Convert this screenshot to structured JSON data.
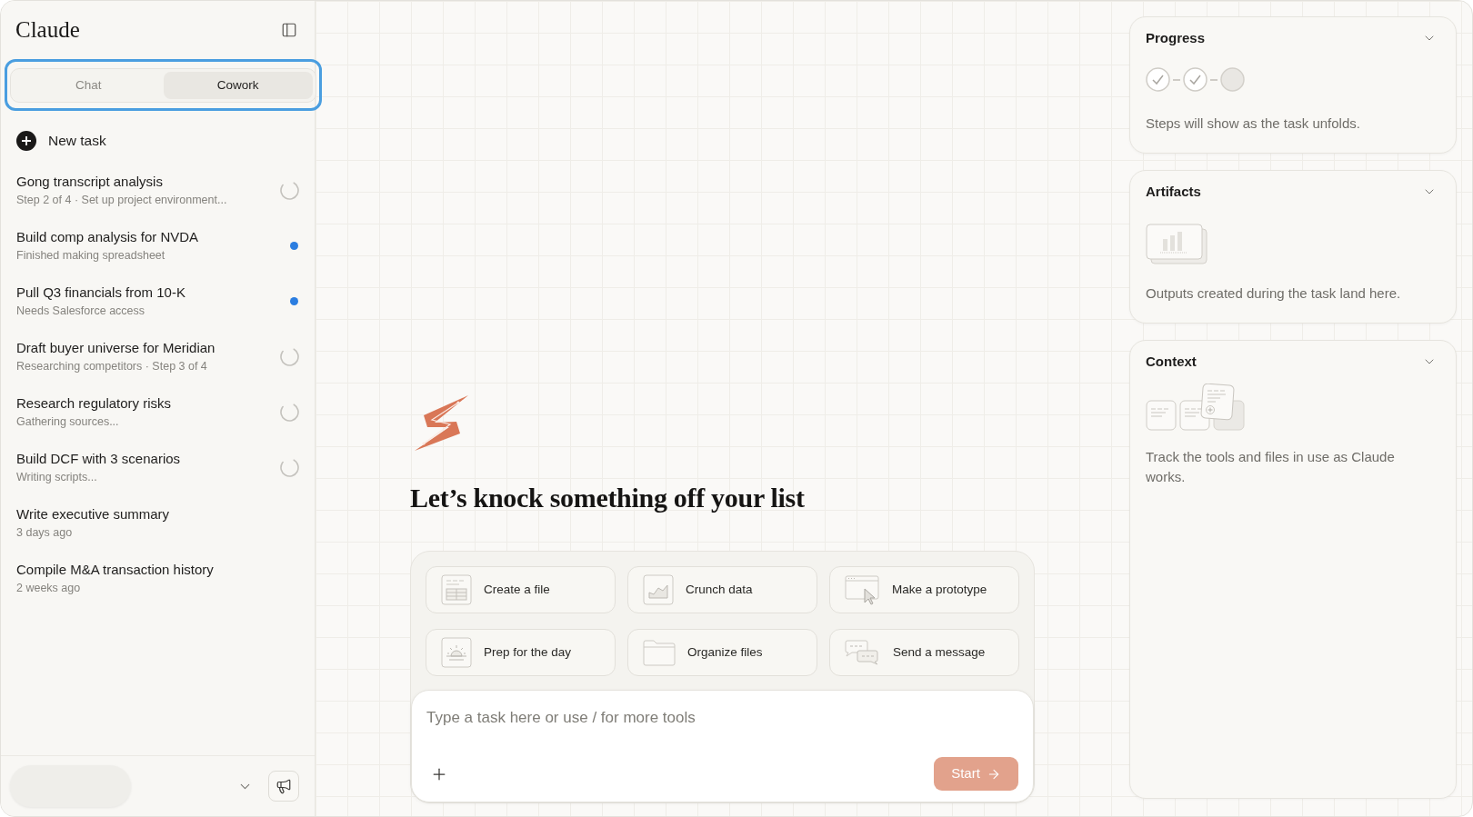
{
  "sidebar": {
    "title": "Claude",
    "mode_tabs": [
      {
        "label": "Chat",
        "selected": false
      },
      {
        "label": "Cowork",
        "selected": true
      }
    ],
    "new_task": "New task",
    "tasks": [
      {
        "title": "Gong transcript analysis",
        "subtitle": "Step 2 of 4 · Set up project environment...",
        "kind": "running"
      },
      {
        "title": "Build comp analysis for NVDA",
        "subtitle": "Finished making spreadsheet",
        "kind": "unread"
      },
      {
        "title": "Pull Q3 financials from 10-K",
        "subtitle": "Needs Salesforce access",
        "kind": "unread"
      },
      {
        "title": "Draft buyer universe for Meridian",
        "subtitle": "Researching competitors · Step 3 of 4",
        "kind": "running"
      },
      {
        "title": "Research regulatory risks",
        "subtitle": "Gathering sources...",
        "kind": "running"
      },
      {
        "title": "Build DCF with 3 scenarios",
        "subtitle": "Writing scripts...",
        "kind": "running"
      },
      {
        "title": "Write executive summary",
        "subtitle": "3 days ago",
        "kind": "idle"
      },
      {
        "title": "Compile M&A transaction history",
        "subtitle": "2 weeks ago",
        "kind": "idle"
      }
    ]
  },
  "main": {
    "heading": "Let’s knock something off your list",
    "quick_actions": [
      "Create a file",
      "Crunch data",
      "Make a prototype",
      "Prep for the day",
      "Organize files",
      "Send a message"
    ],
    "task_input": {
      "placeholder": "Type a task here or use / for more tools"
    },
    "start_button": {
      "label": "Start",
      "disabled": true
    }
  },
  "panels": [
    {
      "kind": "progress",
      "title": "Progress",
      "expanded": true,
      "steps": [
        {
          "done": true
        },
        {
          "done": true
        },
        {
          "done": false
        }
      ],
      "description": "Steps will show as the task unfolds."
    },
    {
      "kind": "artifacts",
      "title": "Artifacts",
      "expanded": true,
      "description": "Outputs created during the task land here."
    },
    {
      "kind": "context",
      "title": "Context",
      "expanded": true,
      "description": "Track the tools and files in use as Claude works."
    }
  ]
}
